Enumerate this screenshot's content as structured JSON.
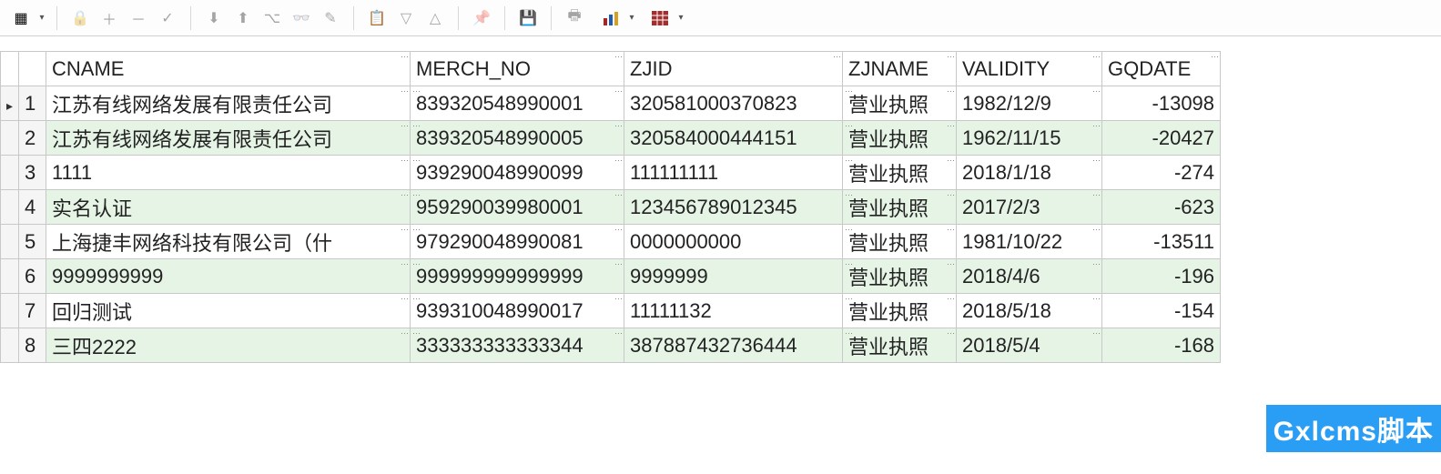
{
  "columns": {
    "cname": "CNAME",
    "merchno": "MERCH_NO",
    "zjid": "ZJID",
    "zjname": "ZJNAME",
    "validity": "VALIDITY",
    "gqdate": "GQDATE"
  },
  "rows": [
    {
      "n": "1",
      "cname": "江苏有线网络发展有限责任公司",
      "merchno": "839320548990001",
      "zjid": "320581000370823",
      "zjname": "营业执照",
      "validity": "1982/12/9",
      "gqdate": "-13098"
    },
    {
      "n": "2",
      "cname": "江苏有线网络发展有限责任公司",
      "merchno": "839320548990005",
      "zjid": "320584000444151",
      "zjname": "营业执照",
      "validity": "1962/11/15",
      "gqdate": "-20427"
    },
    {
      "n": "3",
      "cname": "1111",
      "merchno": "939290048990099",
      "zjid": "111111111",
      "zjname": "营业执照",
      "validity": "2018/1/18",
      "gqdate": "-274"
    },
    {
      "n": "4",
      "cname": "实名认证",
      "merchno": "959290039980001",
      "zjid": "123456789012345",
      "zjname": "营业执照",
      "validity": "2017/2/3",
      "gqdate": "-623"
    },
    {
      "n": "5",
      "cname": "上海捷丰网络科技有限公司（什",
      "merchno": "979290048990081",
      "zjid": "0000000000",
      "zjname": "营业执照",
      "validity": "1981/10/22",
      "gqdate": "-13511"
    },
    {
      "n": "6",
      "cname": "9999999999",
      "merchno": "999999999999999",
      "zjid": "9999999",
      "zjname": "营业执照",
      "validity": "2018/4/6",
      "gqdate": "-196"
    },
    {
      "n": "7",
      "cname": "回归测试",
      "merchno": "939310048990017",
      "zjid": "11111132",
      "zjname": "营业执照",
      "validity": "2018/5/18",
      "gqdate": "-154"
    },
    {
      "n": "8",
      "cname": "三四2222",
      "merchno": "333333333333344",
      "zjid": "387887432736444",
      "zjname": "营业执照",
      "validity": "2018/5/4",
      "gqdate": "-168"
    }
  ],
  "watermark": "Gxlcms脚本"
}
